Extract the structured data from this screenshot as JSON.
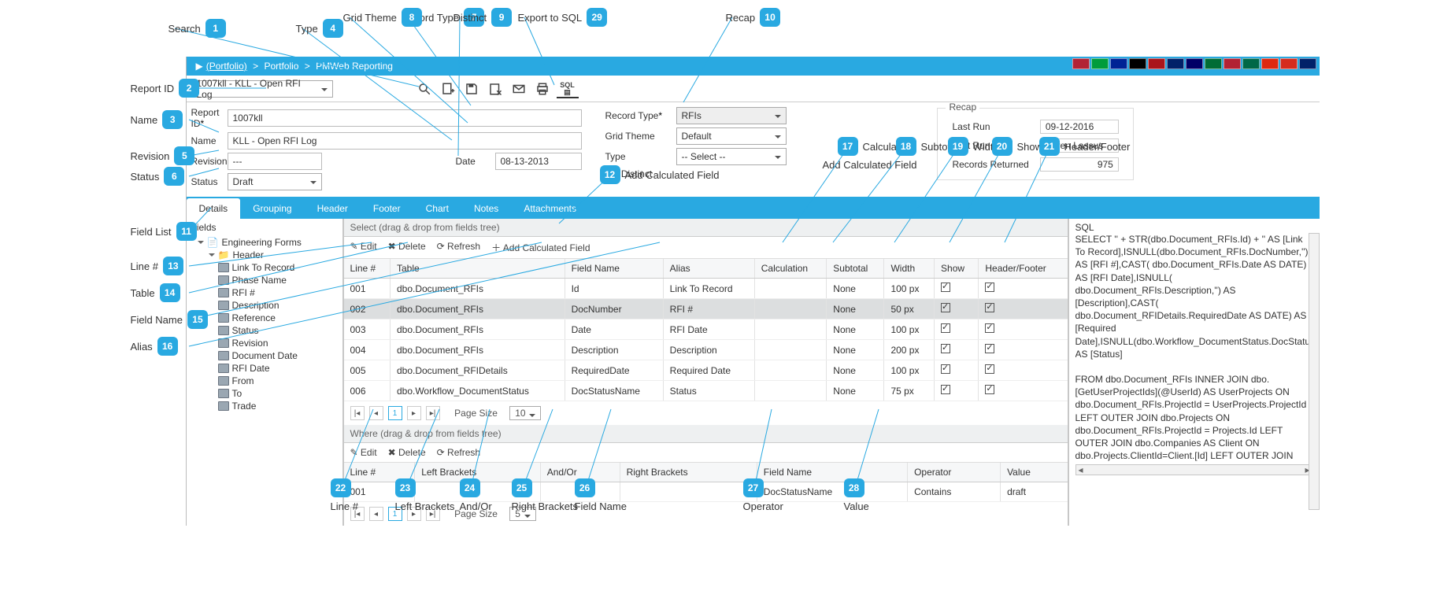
{
  "breadcrumb": {
    "root": "(Portfolio)",
    "mid": "Portfolio",
    "leaf": "PMWeb Reporting"
  },
  "reportDropdown": "1007kll - KLL - Open RFI Log",
  "form": {
    "reportId_lbl": "Report ID",
    "reportId": "1007kll",
    "name_lbl": "Name",
    "name": "KLL - Open RFI Log",
    "revision_lbl": "Revision",
    "revision": "---",
    "date_lbl": "Date",
    "date": "08-13-2013",
    "status_lbl": "Status",
    "status": "Draft"
  },
  "meta": {
    "recordType_lbl": "Record Type",
    "recordType": "RFIs",
    "gridTheme_lbl": "Grid Theme",
    "gridTheme": "Default",
    "type_lbl": "Type",
    "type": "-- Select --",
    "distinct_lbl": "Distinct"
  },
  "addCalc": "Add Calculated Field",
  "recap": {
    "title": "Recap",
    "lastRun_lbl": "Last Run",
    "lastRun": "09-12-2016",
    "lastRunBy_lbl": "Last Run By",
    "lastRunBy": "Karen Lassus",
    "records_lbl": "Records Returned",
    "records": "975"
  },
  "tabs": [
    "Details",
    "Grouping",
    "Header",
    "Footer",
    "Chart",
    "Notes",
    "Attachments"
  ],
  "tree": {
    "title": "Fields",
    "group": "Engineering Forms",
    "sub": "Header",
    "items": [
      "Link To Record",
      "Phase Name",
      "RFI #",
      "Description",
      "Reference",
      "Status",
      "Revision",
      "Document Date",
      "RFI Date",
      "From",
      "To",
      "Trade"
    ]
  },
  "selGrid": {
    "title": "Select (drag & drop from fields tree)",
    "tb": {
      "edit": "Edit",
      "del": "Delete",
      "refresh": "Refresh",
      "add": "Add Calculated Field"
    },
    "cols": [
      "Line #",
      "Table",
      "Field Name",
      "Alias",
      "Calculation",
      "Subtotal",
      "Width",
      "Show",
      "Header/Footer"
    ],
    "rows": [
      {
        "n": "001",
        "t": "dbo.Document_RFIs",
        "f": "Id",
        "a": "Link To Record",
        "c": "",
        "s": "None",
        "w": "100 px",
        "sh": true,
        "hf": true
      },
      {
        "n": "002",
        "t": "dbo.Document_RFIs",
        "f": "DocNumber",
        "a": "RFI #",
        "c": "",
        "s": "None",
        "w": "50 px",
        "sh": true,
        "hf": true
      },
      {
        "n": "003",
        "t": "dbo.Document_RFIs",
        "f": "Date",
        "a": "RFI Date",
        "c": "",
        "s": "None",
        "w": "100 px",
        "sh": true,
        "hf": true
      },
      {
        "n": "004",
        "t": "dbo.Document_RFIs",
        "f": "Description",
        "a": "Description",
        "c": "",
        "s": "None",
        "w": "200 px",
        "sh": true,
        "hf": true
      },
      {
        "n": "005",
        "t": "dbo.Document_RFIDetails",
        "f": "RequiredDate",
        "a": "Required Date",
        "c": "",
        "s": "None",
        "w": "100 px",
        "sh": true,
        "hf": true
      },
      {
        "n": "006",
        "t": "dbo.Workflow_DocumentStatus",
        "f": "DocStatusName",
        "a": "Status",
        "c": "",
        "s": "None",
        "w": "75 px",
        "sh": true,
        "hf": true
      }
    ],
    "pageSize_lbl": "Page Size",
    "pageSize": "10"
  },
  "whereGrid": {
    "title": "Where (drag & drop from fields tree)",
    "cols": [
      "Line #",
      "Left Brackets",
      "And/Or",
      "Right Brackets",
      "Field Name",
      "Operator",
      "Value"
    ],
    "rows": [
      {
        "n": "001",
        "lb": "",
        "ao": "",
        "rb": "",
        "f": "DocStatusName",
        "op": "Contains",
        "v": "draft"
      }
    ],
    "pageSize_lbl": "Page Size",
    "pageSize": "5"
  },
  "sql": {
    "title": "SQL",
    "body": "SELECT '' + STR(dbo.Document_RFIs.Id) + '' AS [Link To Record],ISNULL(dbo.Document_RFIs.DocNumber,'') AS [RFI #],CAST( dbo.Document_RFIs.Date AS DATE) AS [RFI Date],ISNULL( dbo.Document_RFIs.Description,'') AS [Description],CAST( dbo.Document_RFIDetails.RequiredDate AS DATE) AS [Required Date],ISNULL(dbo.Workflow_DocumentStatus.DocStatusName,'') AS [Status]\n\nFROM dbo.Document_RFIs INNER JOIN dbo.[GetUserProjectIds](@UserId) AS UserProjects ON dbo.Document_RFIs.ProjectId = UserProjects.ProjectId LEFT OUTER JOIN dbo.Projects ON dbo.Document_RFIs.ProjectId = Projects.Id LEFT OUTER JOIN dbo.Companies AS Client ON dbo.Projects.ClientId=Client.[Id] LEFT OUTER JOIN dbo.CompanyAddresses AS ClientAddress ON Client.Id=ClientAddress.CompanyId AND ClientAddress.IsPrimary=1 LEFT OUTER JOIN dbo.Companies AS GC ON dbo.Projects.GCId=GC.[Id] LEFT OUTER JOIN dbo.CompanyAddresses AS GCAddress ON GC.Id=GCAddress.CompanyId AND GCAddress.IsPrimary=1 LEFT OUTER JOIN dbo.Companies AS Architect ON dbo.Projects.ArchitectId=Architect.[Id] LEFT OUTER JOIN"
  },
  "callouts": {
    "1": "Search",
    "2": "Report ID",
    "3": "Name",
    "4": "Type",
    "5": "Revision",
    "6": "Status",
    "7": "Record Type",
    "8": "Grid Theme",
    "9": "Distinct",
    "10": "Recap",
    "11": "Field List",
    "12": "Add Calculated Field",
    "13": "Line #",
    "14": "Table",
    "15": "Field Name",
    "16": "Alias",
    "17": "Calculation",
    "18": "Subtotal",
    "19": "Width",
    "20": "Show",
    "21": "Header/Footer",
    "22": "Line #",
    "23": "Left Brackets",
    "24": "And/Or",
    "25": "Right Brackets",
    "26": "Field Name",
    "27": "Operator",
    "28": "Value",
    "29": "Export to SQL"
  },
  "flags": [
    "#b22234",
    "#009c3b",
    "#002395",
    "#000",
    "#aa151b",
    "#012169",
    "#006",
    "#006c35",
    "#b22234",
    "#006847",
    "#de2910",
    "#d52b1e",
    "#012169"
  ]
}
